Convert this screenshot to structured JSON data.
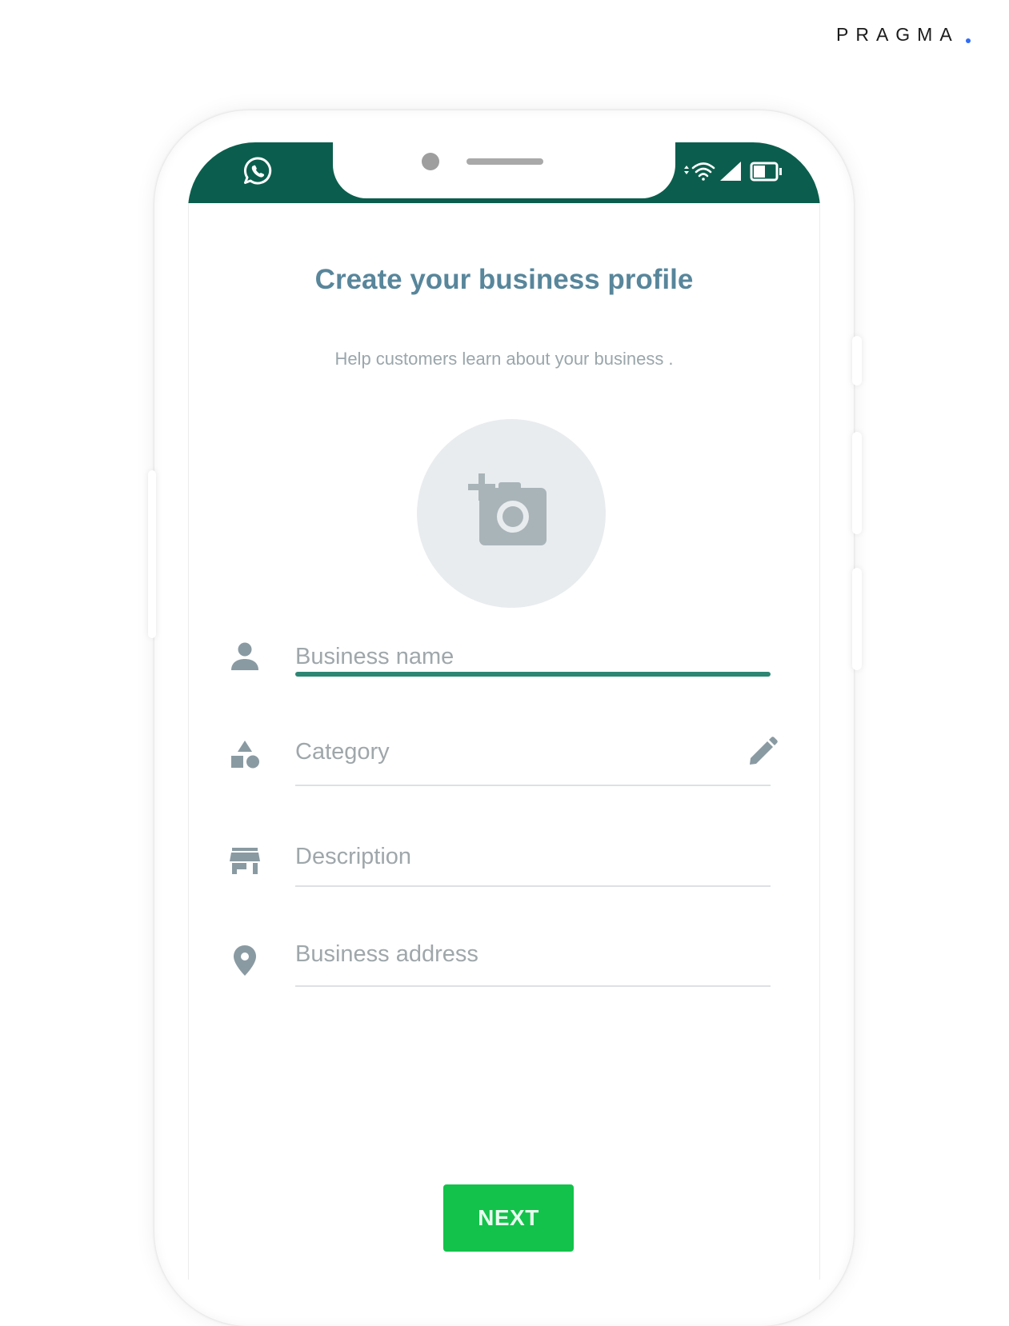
{
  "brand": {
    "name": "PRAGMA",
    "dot_color": "#2f6df6"
  },
  "status_bar": {
    "background": "#0b5e4d",
    "app_icon": "whatsapp-icon",
    "icons": [
      "data-arrows-icon",
      "wifi-icon",
      "signal-icon",
      "battery-icon"
    ]
  },
  "header": {
    "title": "Create your business profile",
    "subtitle": "Help customers learn about your business ."
  },
  "profile_photo": {
    "icon": "add-photo-camera-icon"
  },
  "form": {
    "fields": [
      {
        "icon": "person-icon",
        "placeholder": "Business name",
        "active": true
      },
      {
        "icon": "category-shapes-icon",
        "placeholder": "Category",
        "trailing_icon": "pencil-icon"
      },
      {
        "icon": "store-icon",
        "placeholder": "Description"
      },
      {
        "icon": "location-pin-icon",
        "placeholder": "Business address"
      }
    ],
    "active_underline_color": "#2c8673"
  },
  "actions": {
    "next_label": "NEXT",
    "next_color": "#13c24a"
  }
}
